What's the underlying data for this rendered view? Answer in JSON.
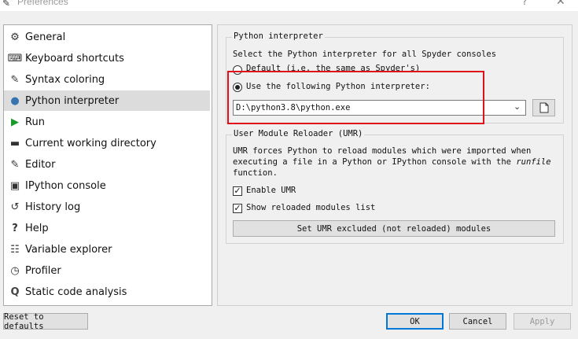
{
  "window": {
    "title": "Preferences",
    "help_glyph": "?",
    "close_glyph": "✕"
  },
  "sidebar": {
    "items": [
      {
        "label": "General",
        "icon": "gear-icon",
        "glyph": "⚙"
      },
      {
        "label": "Keyboard shortcuts",
        "icon": "keyboard-icon",
        "glyph": "⌨"
      },
      {
        "label": "Syntax coloring",
        "icon": "dropper-icon",
        "glyph": "✎"
      },
      {
        "label": "Python interpreter",
        "icon": "python-icon",
        "glyph": "●"
      },
      {
        "label": "Run",
        "icon": "play-icon",
        "glyph": "▶"
      },
      {
        "label": "Current working directory",
        "icon": "folder-icon",
        "glyph": "▬"
      },
      {
        "label": "Editor",
        "icon": "edit-icon",
        "glyph": "✎"
      },
      {
        "label": "IPython console",
        "icon": "ipython-icon",
        "glyph": "▣"
      },
      {
        "label": "History log",
        "icon": "history-icon",
        "glyph": "↺"
      },
      {
        "label": "Help",
        "icon": "help-icon",
        "glyph": "?"
      },
      {
        "label": "Variable explorer",
        "icon": "table-icon",
        "glyph": "☷"
      },
      {
        "label": "Profiler",
        "icon": "clock-icon",
        "glyph": "◷"
      },
      {
        "label": "Static code analysis",
        "icon": "search-icon",
        "glyph": "Q"
      }
    ],
    "selected": "Python interpreter"
  },
  "interpreter": {
    "group_title": "Python interpreter",
    "description": "Select the Python interpreter for all Spyder consoles",
    "default_option": "Default (i.e. the same as Spyder's)",
    "custom_option": "Use the following Python interpreter:",
    "path_value": "D:\\python3.8\\python.exe"
  },
  "umr": {
    "group_title": "User Module Reloader (UMR)",
    "description_line1": "UMR forces Python to reload modules which were imported when",
    "description_line2_prefix": "executing a file in a Python or IPython console with the ",
    "description_line2_em": "runfile",
    "description_line3": "function.",
    "enable_label": "Enable UMR",
    "show_label": "Show reloaded modules list",
    "excluded_button": "Set UMR excluded (not reloaded) modules"
  },
  "footer": {
    "reset_label": "Reset to defaults",
    "ok_label": "OK",
    "cancel_label": "Cancel",
    "apply_label": "Apply"
  },
  "colors": {
    "highlight": "#e0101b",
    "default_button_border": "#0078d7",
    "selected_item": "#dcdcdc"
  }
}
